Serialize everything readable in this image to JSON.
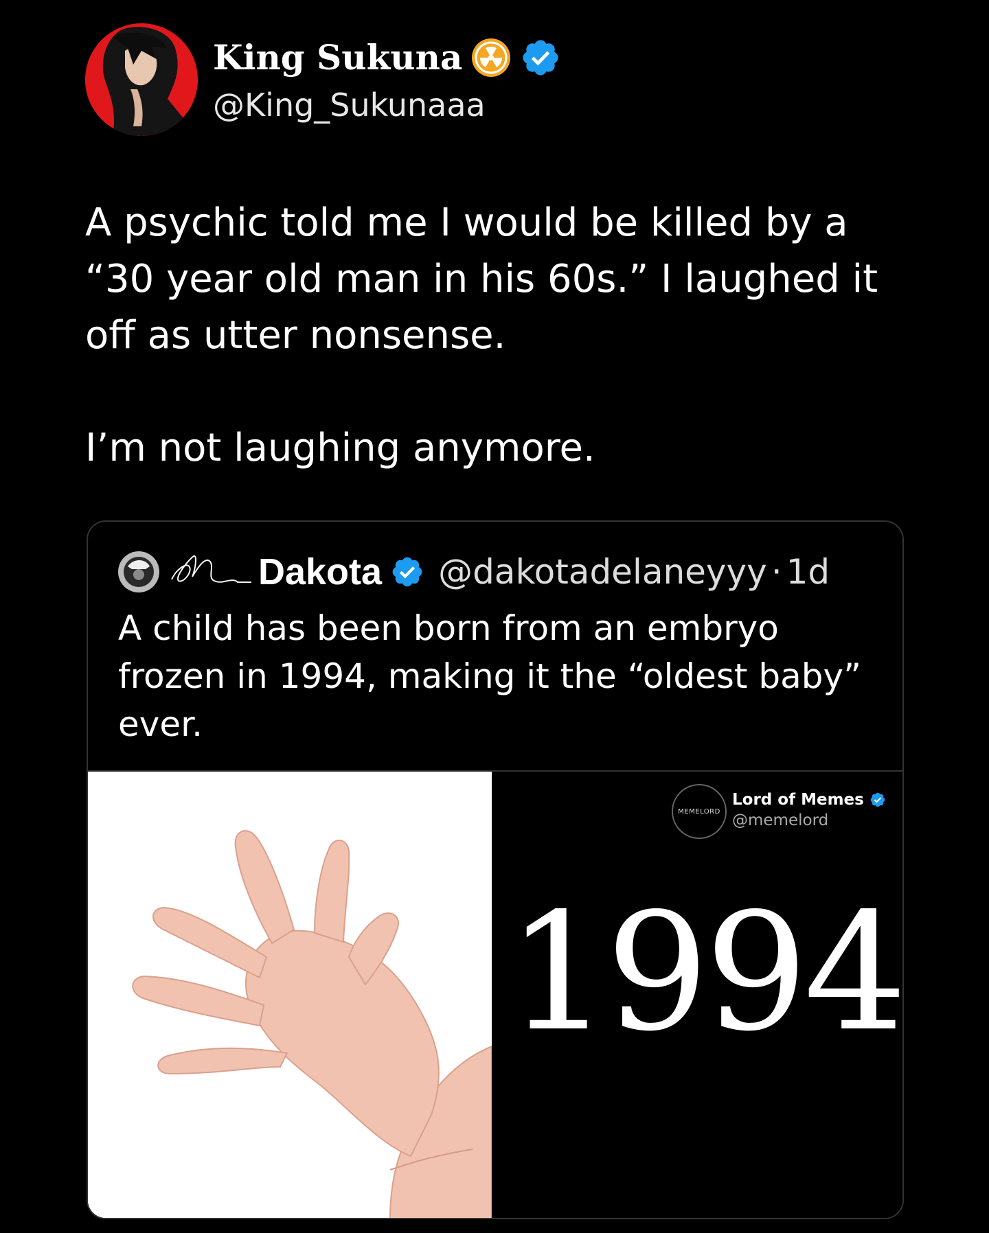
{
  "author": {
    "name": "King Sukuna",
    "handle": "@King_Sukunaaa",
    "badges": [
      "radioactive-icon",
      "verified-icon"
    ]
  },
  "tweet": {
    "paragraphs": [
      "A psychic told me I would be killed by a “30 year old man in his 60s.” I laughed it off as utter nonsense.",
      "I’m not laughing anymore."
    ]
  },
  "quoted": {
    "name": "Dakota",
    "handle": "@dakotadelaneyyy",
    "separator": "·",
    "time": "1d",
    "text": "A child has been born from an embryo frozen in 1994, making it the “oldest baby” ever.",
    "media": {
      "logo_text": "MEMELORD",
      "account_name": "Lord of Memes",
      "account_handle": "@memelord",
      "year": "1994"
    }
  },
  "colors": {
    "background": "#000000",
    "verified": "#1d9bf0",
    "radioactive": "#f5a623",
    "avatar_red": "#e0171b"
  }
}
